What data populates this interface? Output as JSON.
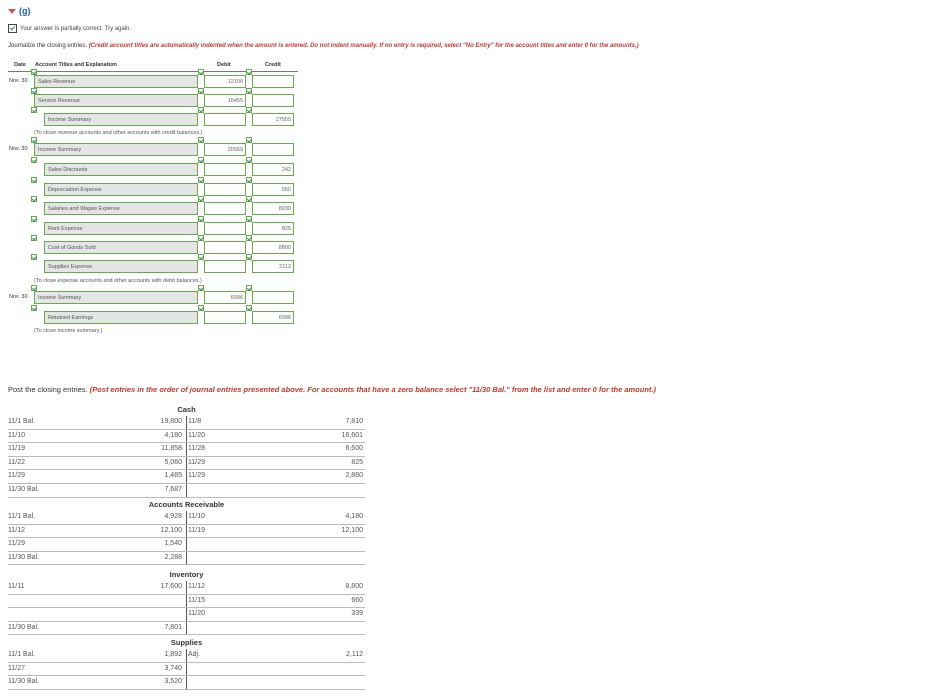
{
  "part_label": "(g)",
  "status_text": "Your answer is partially correct.  Try again.",
  "instructions": {
    "lead": "Journalize the closing entries. ",
    "red": "(Credit account titles are automatically indented when the amount is entered. Do not indent manually. If no entry is required, select \"No Entry\" for the account titles and enter 0 for the amounts.)"
  },
  "journal_headers": {
    "date": "Date",
    "account": "Account Titles and Explanation",
    "debit": "Debit",
    "credit": "Credit"
  },
  "journal_rows": [
    {
      "date": "Nov. 30",
      "account": "Sales Revenue",
      "debit": "12100",
      "credit": ""
    },
    {
      "date": "",
      "account": "Service Revenue",
      "debit": "15455",
      "credit": ""
    },
    {
      "date": "",
      "account": "Income Summary",
      "debit": "",
      "credit": "27555"
    },
    {
      "date": "Nov. 30",
      "account": "Income Summary",
      "debit": "20559",
      "credit": ""
    },
    {
      "date": "",
      "account": "Sales Discounts",
      "debit": "",
      "credit": "242"
    },
    {
      "date": "",
      "account": "Depreciation Expense",
      "debit": "",
      "credit": "550"
    },
    {
      "date": "",
      "account": "Salaries and Wages Expense",
      "debit": "",
      "credit": "8030"
    },
    {
      "date": "",
      "account": "Rent Expense",
      "debit": "",
      "credit": "825"
    },
    {
      "date": "",
      "account": "Cost of Goods Sold",
      "debit": "",
      "credit": "8800"
    },
    {
      "date": "",
      "account": "Supplies Expense",
      "debit": "",
      "credit": "2112"
    },
    {
      "date": "Nov. 30",
      "account": "Income Summary",
      "debit": "6996",
      "credit": ""
    },
    {
      "date": "",
      "account": "Retained Earnings",
      "debit": "",
      "credit": "6996"
    }
  ],
  "explanations": [
    "(To close revenue accounts and other accounts with credit balances.)",
    "(To close expense accounts and other accounts with debit balances.)",
    "(To close income summary.)"
  ],
  "post_instructions": {
    "lead": "Post the closing entries. ",
    "red": "(Post entries in the order of journal entries presented above. For accounts that have a zero balance select \"11/30 Bal.\" from the list and enter 0 for the amount.)"
  },
  "ledgers": [
    {
      "title": "Cash",
      "rows": [
        {
          "ld": "11/1 Bal.",
          "la": "19,800",
          "rd": "11/8",
          "ra": "7,810"
        },
        {
          "ld": "11/10",
          "la": "4,180",
          "rd": "11/20",
          "ra": "16,601"
        },
        {
          "ld": "11/19",
          "la": "11,858",
          "rd": "11/28",
          "ra": "6,600"
        },
        {
          "ld": "11/22",
          "la": "5,060",
          "rd": "11/29",
          "ra": "825"
        },
        {
          "ld": "11/29",
          "la": "1,485",
          "rd": "11/29",
          "ra": "2,860"
        },
        {
          "ld": "11/30 Bal.",
          "la": "7,687",
          "rd": "",
          "ra": ""
        }
      ]
    },
    {
      "title": "Accounts Receivable",
      "rows": [
        {
          "ld": "11/1 Bal.",
          "la": "4,928",
          "rd": "11/10",
          "ra": "4,180"
        },
        {
          "ld": "11/12",
          "la": "12,100",
          "rd": "11/19",
          "ra": "12,100"
        },
        {
          "ld": "11/29",
          "la": "1,540",
          "rd": "",
          "ra": ""
        },
        {
          "ld": "11/30 Bal.",
          "la": "2,288",
          "rd": "",
          "ra": ""
        }
      ]
    },
    {
      "title": "Inventory",
      "rows": [
        {
          "ld": "11/11",
          "la": "17,600",
          "rd": "11/12",
          "ra": "8,800"
        },
        {
          "ld": "",
          "la": "",
          "rd": "11/15",
          "ra": "660"
        },
        {
          "ld": "",
          "la": "",
          "rd": "11/20",
          "ra": "339"
        },
        {
          "ld": "11/30 Bal.",
          "la": "7,801",
          "rd": "",
          "ra": ""
        }
      ]
    },
    {
      "title": "Supplies",
      "rows": [
        {
          "ld": "11/1 Bal.",
          "la": "1,892",
          "rd": "Adj.",
          "ra": "2,112"
        },
        {
          "ld": "11/27",
          "la": "3,740",
          "rd": "",
          "ra": ""
        },
        {
          "ld": "11/30 Bal.",
          "la": "3,520",
          "rd": "",
          "ra": ""
        }
      ]
    }
  ]
}
